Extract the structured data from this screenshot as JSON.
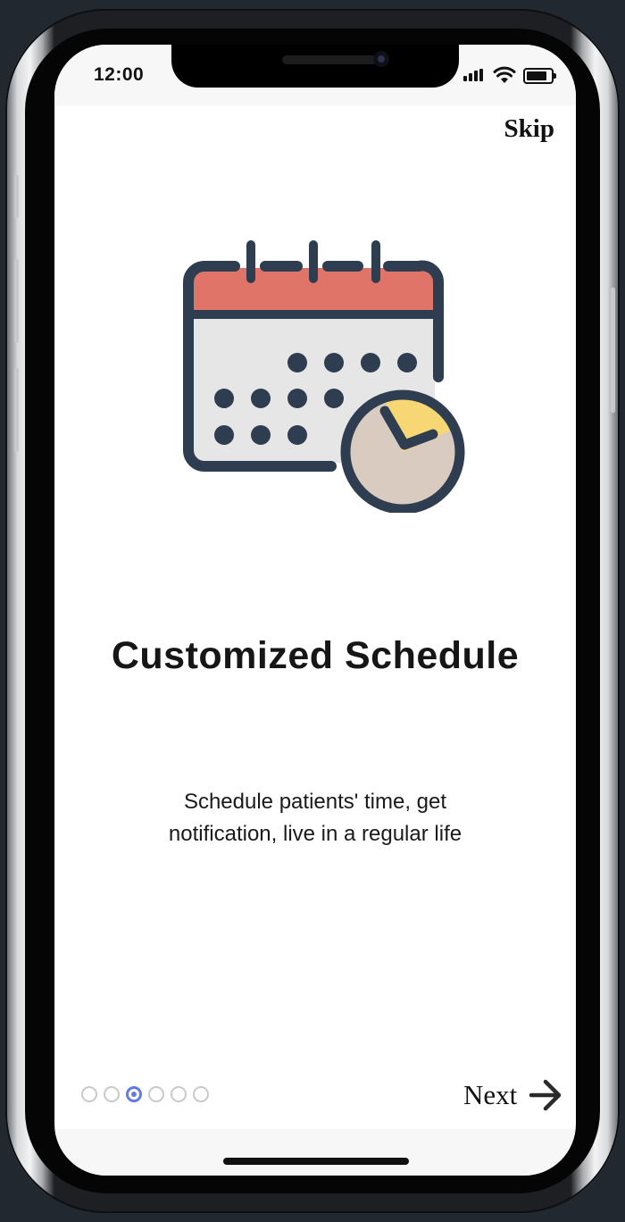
{
  "status_bar": {
    "time": "12:00",
    "icons": [
      "cellular-signal-icon",
      "wifi-icon",
      "battery-icon"
    ]
  },
  "onboarding": {
    "skip_label": "Skip",
    "illustration_icon": "calendar-clock-icon",
    "title": "Customized Schedule",
    "description": "Schedule patients' time, get notification, live in a regular life",
    "page_count": 6,
    "current_page": 3,
    "next_label": "Next",
    "next_icon": "arrow-right-icon"
  },
  "colors": {
    "accent": "#6579e3",
    "calendar_header": "#e07468",
    "calendar_body": "#e6e6e6",
    "outline": "#2e3d50",
    "clock_face": "#d9cbc0",
    "clock_highlight": "#f7d774",
    "phone_background": "#212830"
  }
}
